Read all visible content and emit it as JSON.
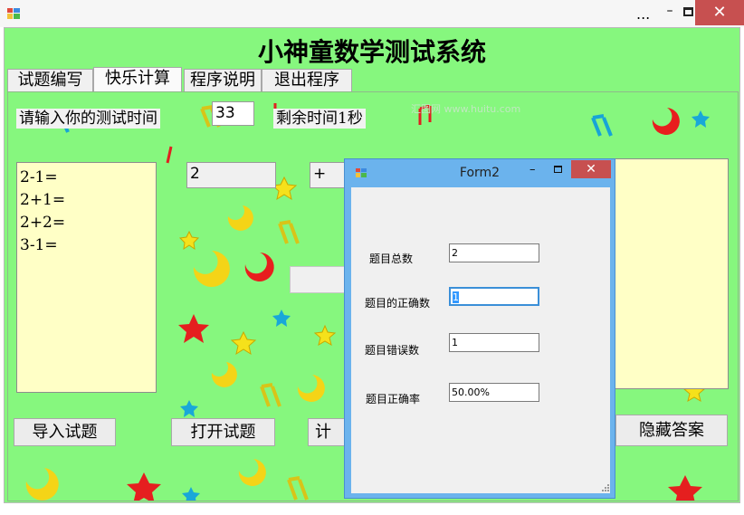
{
  "window": {
    "dots": "...",
    "min": "–",
    "close": "✕"
  },
  "app": {
    "title": "小神童数学测试系统"
  },
  "tabs": [
    "试题编写",
    "快乐计算",
    "程序说明",
    "退出程序"
  ],
  "main": {
    "time_prompt": "请输入你的测试时间",
    "time_value": "33",
    "remaining": "剩余时间1秒",
    "questions": [
      "2-1=",
      "2+1=",
      "2+2=",
      "3-1="
    ],
    "operand1": "2",
    "operator": "+",
    "buttons": {
      "import": "导入试题",
      "open": "打开试题",
      "timer": "计时",
      "hide": "隐藏答案"
    },
    "watermark": "汇图网 www.huitu.com"
  },
  "dialog": {
    "title": "Form2",
    "min": "–",
    "close": "✕",
    "rows": [
      {
        "label": "题目总数",
        "value": "2"
      },
      {
        "label": "题目的正确数",
        "value": "1"
      },
      {
        "label": "题目错误数",
        "value": "1"
      },
      {
        "label": "题目正确率",
        "value": "50.00%"
      }
    ]
  },
  "colors": {
    "form_green": "#86f77e",
    "list_yellow": "#ffffc6",
    "dialog_border": "#6bb3ed",
    "close_red": "#c75050"
  }
}
